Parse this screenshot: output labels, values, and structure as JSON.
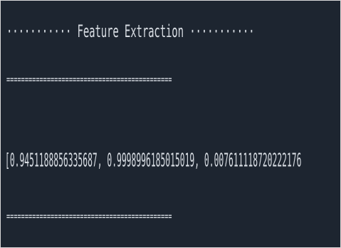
{
  "console": {
    "lines": {
      "header": "··········· Feature Extraction ···········",
      "separator_top": "=============================================",
      "feature_vector": "[0.9451188856335687, 0.9998996185015019, 0.007611118720222176",
      "separator_bottom": "============================================="
    },
    "colors": {
      "background": "#1d2530",
      "text": "#d8dde3"
    }
  }
}
